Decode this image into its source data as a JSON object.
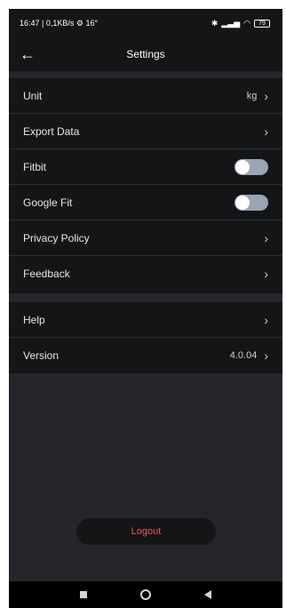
{
  "status": {
    "time": "16:47",
    "network_speed": "| 0,1KB/s",
    "temp": "16°",
    "battery": "79"
  },
  "header": {
    "title": "Settings"
  },
  "settings_section": [
    {
      "label": "Unit",
      "value": "kg"
    },
    {
      "label": "Export Data",
      "value": ""
    },
    {
      "label": "Fitbit",
      "toggle": false
    },
    {
      "label": "Google Fit",
      "toggle": false
    },
    {
      "label": "Privacy Policy",
      "value": ""
    },
    {
      "label": "Feedback",
      "value": ""
    }
  ],
  "help_section": [
    {
      "label": "Help",
      "value": ""
    },
    {
      "label": "Version",
      "value": "4.0.04"
    }
  ],
  "logout_label": "Logout",
  "icons": {
    "back": "arrow-left-icon",
    "chevron": "chevron-right-icon",
    "nav_recent": "square-icon",
    "nav_home": "circle-icon",
    "nav_back": "triangle-back-icon"
  },
  "colors": {
    "background": "#24262b",
    "card": "#141517",
    "logout_text": "#e25a59",
    "toggle_off": "#9aa4b5"
  }
}
